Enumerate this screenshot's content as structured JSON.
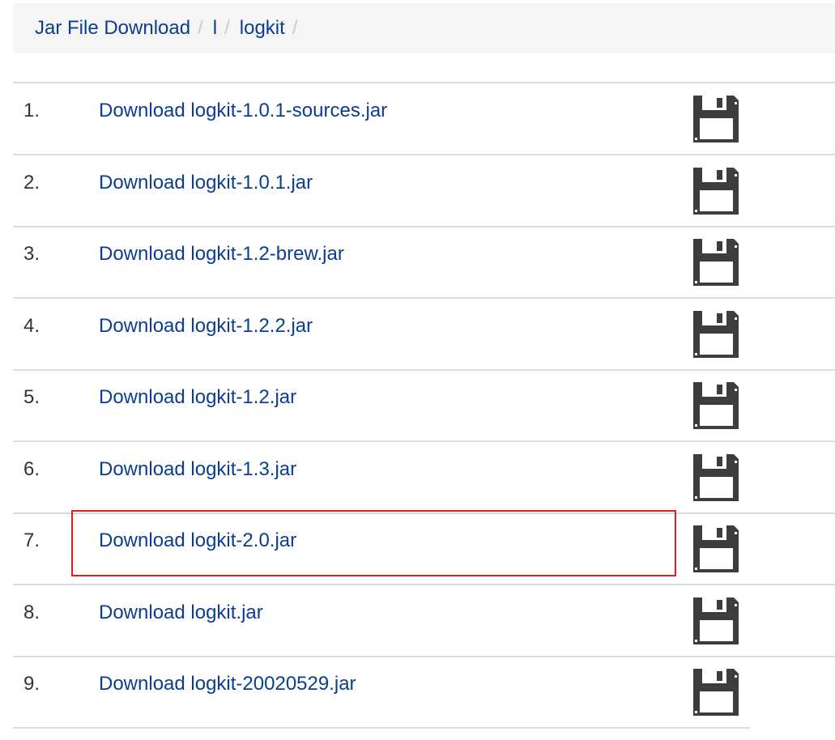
{
  "breadcrumb": {
    "items": [
      "Jar File Download",
      "l",
      "logkit"
    ],
    "separator": "/"
  },
  "rows": [
    {
      "index": "1.",
      "link": "Download logkit-1.0.1-sources.jar",
      "icon": "floppy-disk-icon"
    },
    {
      "index": "2.",
      "link": "Download logkit-1.0.1.jar",
      "icon": "floppy-disk-icon"
    },
    {
      "index": "3.",
      "link": "Download logkit-1.2-brew.jar",
      "icon": "floppy-disk-icon"
    },
    {
      "index": "4.",
      "link": "Download logkit-1.2.2.jar",
      "icon": "floppy-disk-icon"
    },
    {
      "index": "5.",
      "link": "Download logkit-1.2.jar",
      "icon": "floppy-disk-icon"
    },
    {
      "index": "6.",
      "link": "Download logkit-1.3.jar",
      "icon": "floppy-disk-icon"
    },
    {
      "index": "7.",
      "link": "Download logkit-2.0.jar",
      "icon": "floppy-disk-icon"
    },
    {
      "index": "8.",
      "link": "Download logkit.jar",
      "icon": "floppy-disk-icon"
    },
    {
      "index": "9.",
      "link": "Download logkit-20020529.jar",
      "icon": "floppy-disk-icon"
    }
  ],
  "highlighted_row": "7.",
  "colors": {
    "link": "#0b3d91",
    "highlight_border": "#e21b1b",
    "breadcrumb_bg": "#f5f5f5",
    "row_border": "#dddddd"
  }
}
